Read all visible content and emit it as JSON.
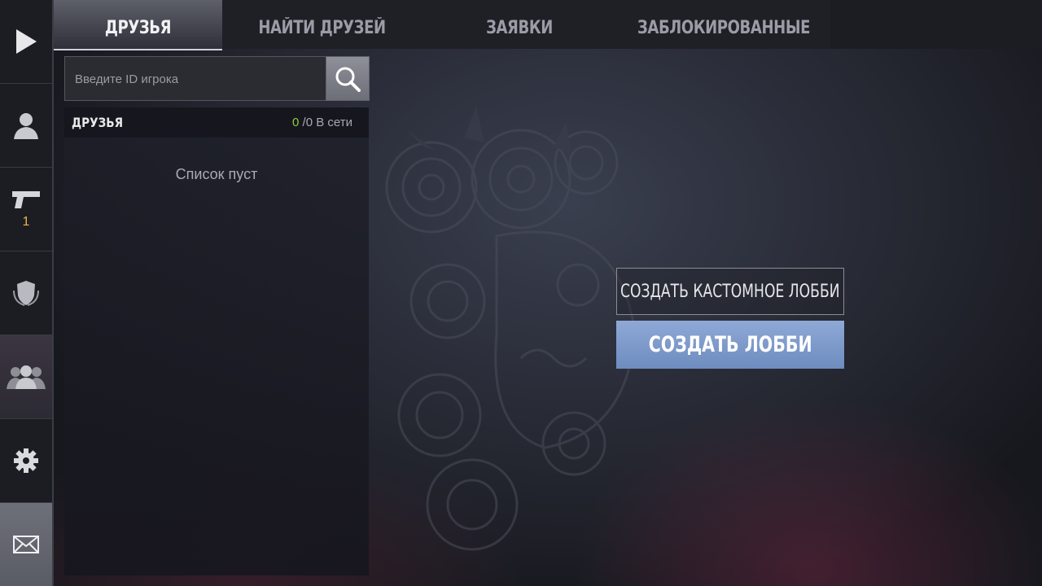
{
  "tabs": [
    {
      "label": "ДРУЗЬЯ",
      "active": true
    },
    {
      "label": "НАЙТИ ДРУЗЕЙ",
      "active": false
    },
    {
      "label": "ЗАЯВКИ",
      "active": false
    },
    {
      "label": "ЗАБЛОКИРОВАННЫЕ",
      "active": false
    }
  ],
  "sidebar": {
    "items": [
      {
        "icon": "play-icon"
      },
      {
        "icon": "profile-icon"
      },
      {
        "icon": "pistol-icon",
        "badge": "1"
      },
      {
        "icon": "shield-icon"
      },
      {
        "icon": "friends-icon",
        "active": true
      },
      {
        "icon": "gear-icon"
      },
      {
        "icon": "mail-icon"
      }
    ]
  },
  "search": {
    "placeholder": "Введите ID игрока",
    "icon": "search-icon"
  },
  "friends": {
    "title": "ДРУЗЬЯ",
    "online": "0",
    "separator": "/",
    "total_label": "0 В сети",
    "empty_text": "Список пуст"
  },
  "lobby": {
    "custom_label": "СОЗДАТЬ КАСТОМНОЕ ЛОББИ",
    "create_label": "СОЗДАТЬ ЛОББИ"
  },
  "colors": {
    "accent_blue": "#7f9bcc",
    "online_green": "#8ccc3c",
    "badge_yellow": "#e9b64a"
  }
}
